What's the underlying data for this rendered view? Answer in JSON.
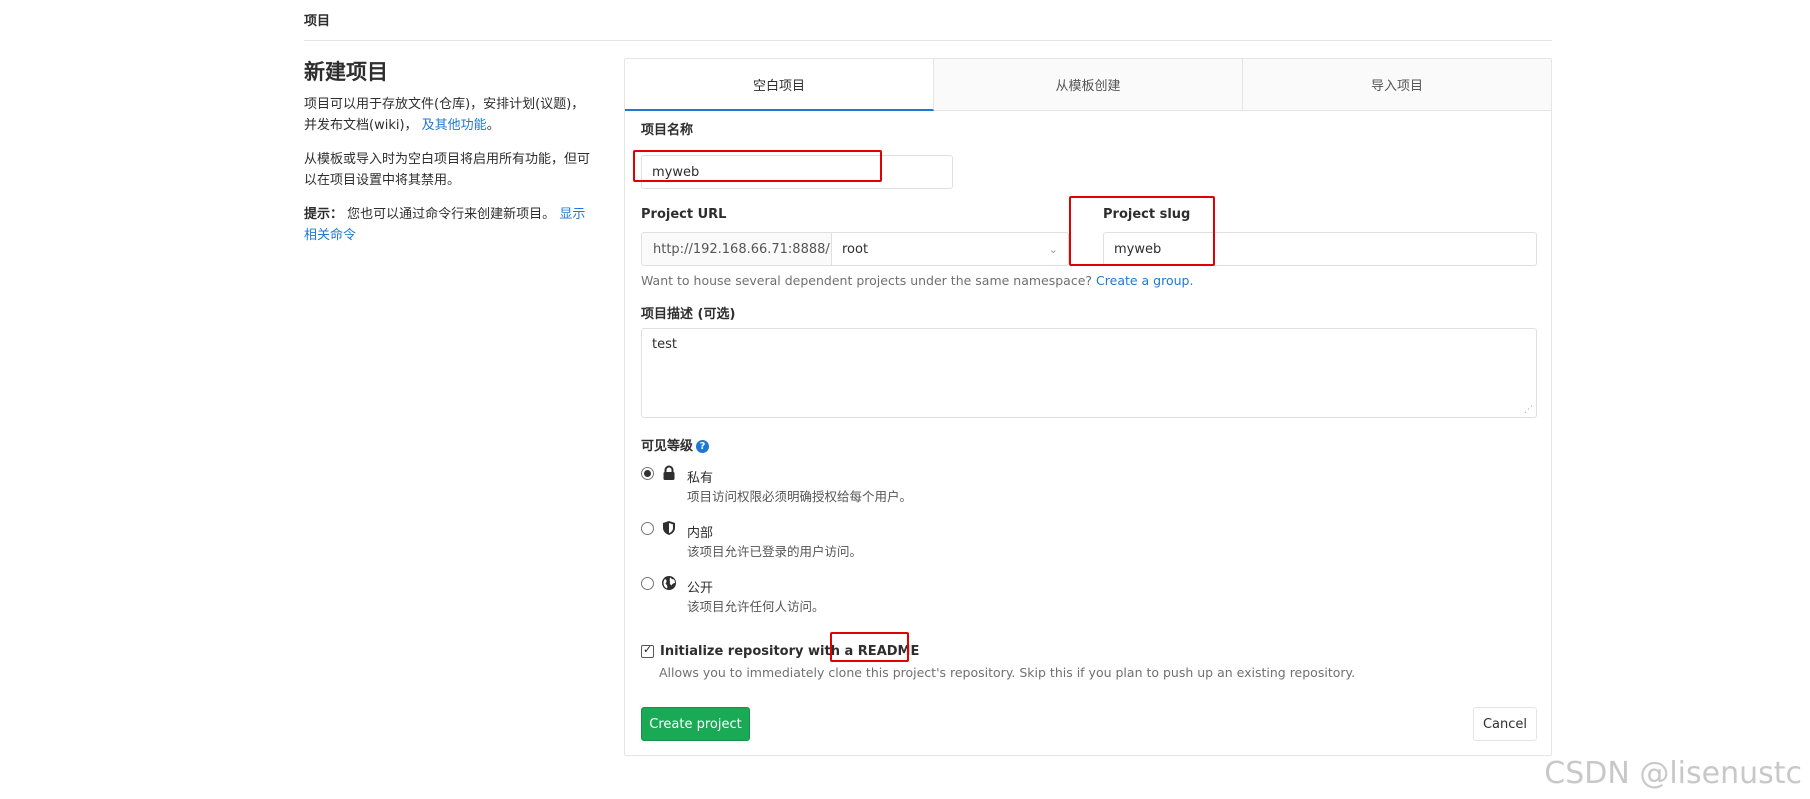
{
  "breadcrumb": "项目",
  "sidebar": {
    "title": "新建项目",
    "desc1": "项目可以用于存放文件(仓库)，安排计划(议题)，并发布文档(wiki)，",
    "desc1_link": "及其他功能",
    "desc1_end": "。",
    "desc2": "从模板或导入时为空白项目将启用所有功能，但可以在项目设置中将其禁用。",
    "tip_label": "提示：",
    "tip_text": "您也可以通过命令行来创建新项目。",
    "tip_link": "显示相关命令"
  },
  "tabs": [
    {
      "label": "空白项目",
      "active": true
    },
    {
      "label": "从模板创建",
      "active": false
    },
    {
      "label": "导入项目",
      "active": false
    }
  ],
  "form": {
    "name_label": "项目名称",
    "name_value": "myweb",
    "url_label": "Project URL",
    "url_prefix": "http://192.168.66.71:8888/",
    "namespace": "root",
    "slug_label": "Project slug",
    "slug_value": "myweb",
    "namespace_help": "Want to house several dependent projects under the same namespace?",
    "namespace_help_link": "Create a group.",
    "desc_label": "项目描述 (可选)",
    "desc_value": "test",
    "visibility_label": "可见等级",
    "visibility": [
      {
        "title": "私有",
        "desc": "项目访问权限必须明确授权给每个用户。",
        "checked": true,
        "icon": "lock-icon"
      },
      {
        "title": "内部",
        "desc": "该项目允许已登录的用户访问。",
        "checked": false,
        "icon": "shield-icon"
      },
      {
        "title": "公开",
        "desc": "该项目允许任何人访问。",
        "checked": false,
        "icon": "globe-icon"
      }
    ],
    "readme_label_prefix": "Initialize repository with a",
    "readme_label_strong": "README",
    "readme_help": "Allows you to immediately clone this project's repository. Skip this if you plan to push up an existing repository.",
    "create_button": "Create project",
    "cancel_button": "Cancel"
  },
  "colors": {
    "accent": "#1f78d1",
    "primary_button": "#1aaa55",
    "annotation": "#e00000"
  },
  "watermark": "CSDN @lisenustc"
}
